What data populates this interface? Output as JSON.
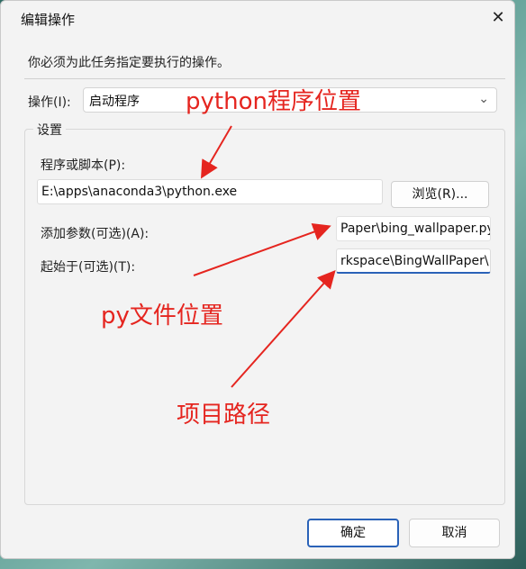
{
  "window": {
    "title": "编辑操作"
  },
  "intro": "你必须为此任务指定要执行的操作。",
  "action": {
    "label": "操作(I):",
    "value": "启动程序"
  },
  "settings": {
    "group_title": "设置",
    "program_label": "程序或脚本(P):",
    "program_value": "E:\\apps\\anaconda3\\python.exe",
    "browse_label": "浏览(R)...",
    "args_label": "添加参数(可选)(A):",
    "args_value": "Paper\\bing_wallpaper.py",
    "start_label": "起始于(可选)(T):",
    "start_value": "rkspace\\BingWallPaper\\"
  },
  "buttons": {
    "ok": "确定",
    "cancel": "取消"
  },
  "annotations": {
    "python_location": "python程序位置",
    "py_file_location": "py文件位置",
    "project_path": "项目路径"
  },
  "colors": {
    "annotation": "#e5251f",
    "primary_button_border": "#2a62b8"
  }
}
